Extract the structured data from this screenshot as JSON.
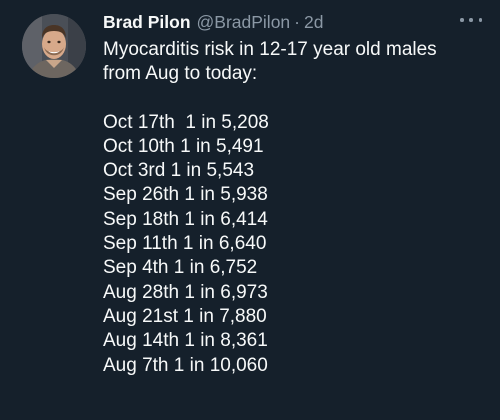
{
  "author": {
    "display_name": "Brad Pilon",
    "handle": "@BradPilon",
    "separator": "·",
    "time": "2d",
    "avatar_icon": "profile-photo-avatar"
  },
  "more_icon": "more-options-icon",
  "tweet": {
    "intro_lines": [
      "Myocarditis risk in 12-17 year old males",
      "from Aug to today:"
    ],
    "entries": [
      "Oct 17th  1 in 5,208",
      "Oct 10th 1 in 5,491",
      "Oct 3rd 1 in 5,543",
      "Sep 26th 1 in 5,938",
      "Sep 18th 1 in 6,414",
      "Sep 11th 1 in 6,640",
      "Sep 4th 1 in 6,752",
      "Aug 28th 1 in 6,973",
      "Aug 21st 1 in 7,880",
      "Aug 14th 1 in 8,361",
      "Aug 7th 1 in 10,060"
    ]
  },
  "colors": {
    "background": "#15202b",
    "primary_text": "#f7f9f9",
    "secondary_text": "#8b98a5"
  }
}
